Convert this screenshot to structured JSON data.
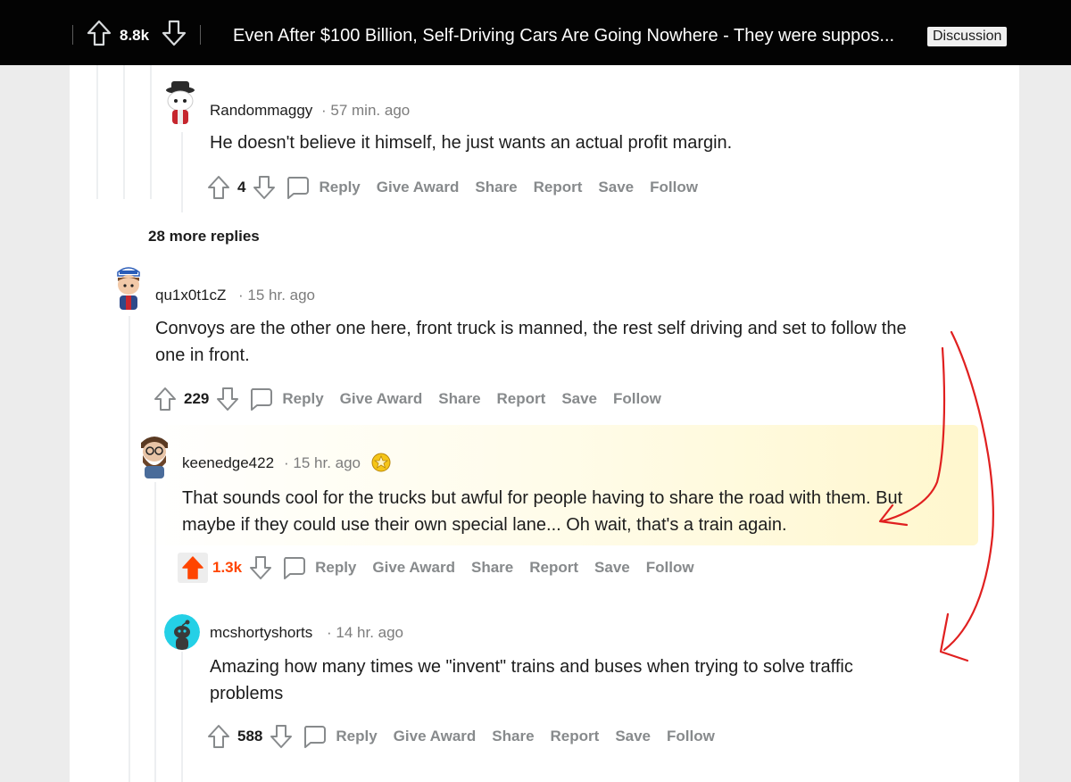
{
  "topbar": {
    "score": "8.8k",
    "title": "Even After $100 Billion, Self-Driving Cars Are Going Nowhere - They were suppos...",
    "flair": "Discussion"
  },
  "comments": [
    {
      "username": "Randommaggy",
      "time": "57 min. ago",
      "body": "He doesn't believe it himself, he just wants an actual profit margin.",
      "score": "4",
      "actions": [
        "Reply",
        "Give Award",
        "Share",
        "Report",
        "Save",
        "Follow"
      ]
    },
    {
      "username": "qu1x0t1cZ",
      "time": "15 hr. ago",
      "body": "Convoys are the other one here, front truck is manned, the rest self driving and set to follow the one in front.",
      "score": "229",
      "actions": [
        "Reply",
        "Give Award",
        "Share",
        "Report",
        "Save",
        "Follow"
      ]
    },
    {
      "username": "keenedge422",
      "time": "15 hr. ago",
      "body": "That sounds cool for the trucks but awful for people having to share the road with them. But maybe if they could use their own special lane... Oh wait, that's a train again.",
      "score": "1.3k",
      "actions": [
        "Reply",
        "Give Award",
        "Share",
        "Report",
        "Save",
        "Follow"
      ]
    },
    {
      "username": "mcshortyshorts",
      "time": "14 hr. ago",
      "body": "Amazing how many times we \"invent\" trains and buses when trying to solve traffic problems",
      "score": "588",
      "actions": [
        "Reply",
        "Give Award",
        "Share",
        "Report",
        "Save",
        "Follow"
      ]
    }
  ],
  "more_replies": "28 more replies",
  "colors": {
    "upvote_active": "#ff4500",
    "annotation": "#e02020",
    "action_gray": "#878a8c"
  },
  "icons": [
    "upvote-icon",
    "downvote-icon",
    "comment-icon",
    "award-badge-icon",
    "default-snoo-avatar"
  ]
}
